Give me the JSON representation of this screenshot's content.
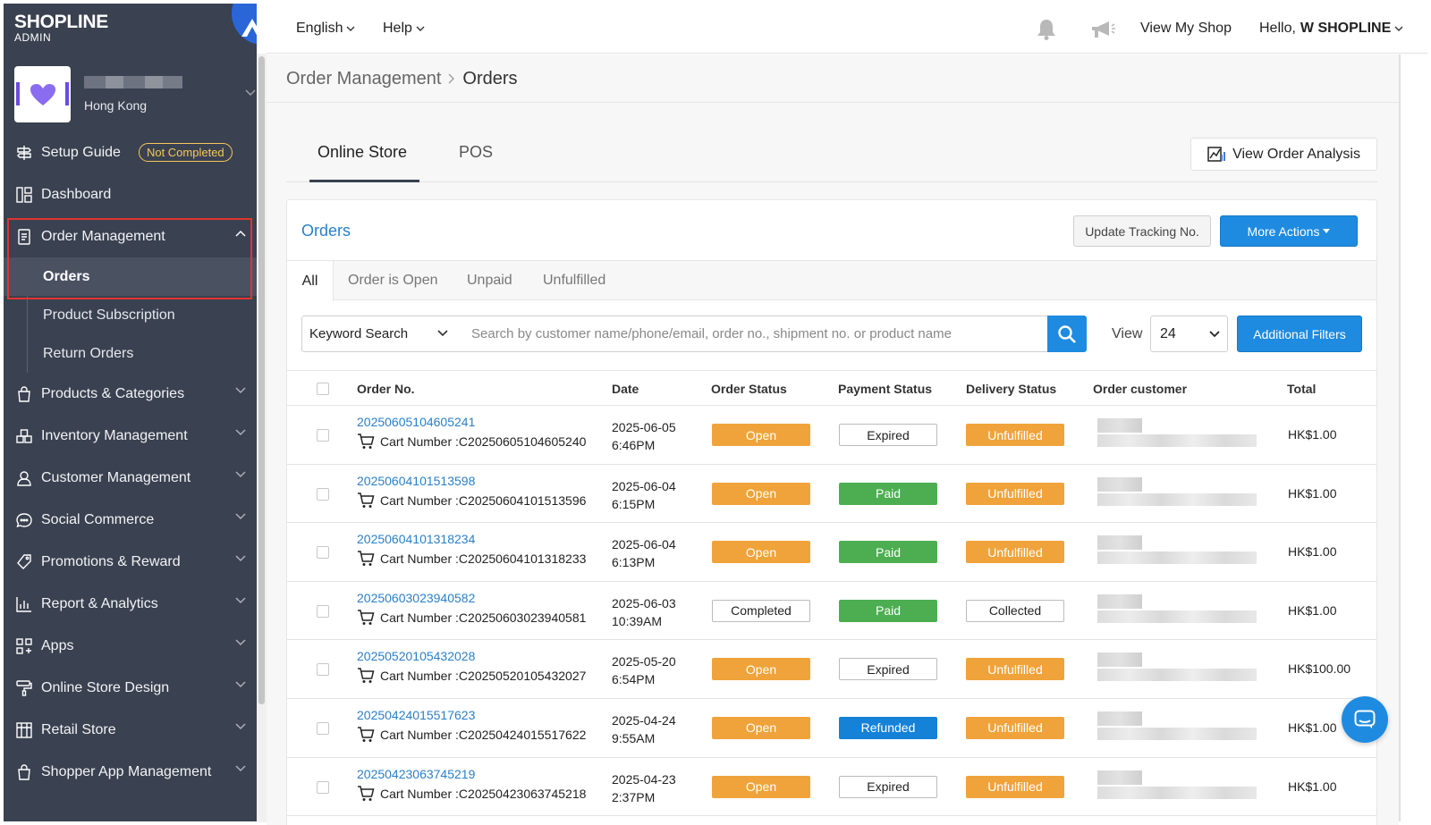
{
  "brand": {
    "logo": "SHOPLINE",
    "sub": "ADMIN"
  },
  "store": {
    "region": "Hong Kong"
  },
  "sidebar": {
    "setup_guide": {
      "label": "Setup Guide",
      "badge": "Not Completed"
    },
    "dashboard": "Dashboard",
    "order_management": {
      "label": "Order Management",
      "children": [
        "Orders",
        "Product Subscription",
        "Return Orders"
      ]
    },
    "items": [
      "Products & Categories",
      "Inventory Management",
      "Customer Management",
      "Social Commerce",
      "Promotions & Reward",
      "Report & Analytics",
      "Apps",
      "Online Store Design",
      "Retail Store",
      "Shopper App Management"
    ]
  },
  "topbar": {
    "language": "English",
    "help": "Help",
    "view_shop": "View My Shop",
    "greeting": "Hello,",
    "user": "W SHOPLINE"
  },
  "breadcrumb": {
    "parent": "Order Management",
    "current": "Orders"
  },
  "store_tabs": [
    "Online Store",
    "POS"
  ],
  "analysis_button": "View Order Analysis",
  "panel": {
    "title": "Orders",
    "update_tracking": "Update Tracking No.",
    "more_actions": "More Actions",
    "status_tabs": [
      "All",
      "Order is Open",
      "Unpaid",
      "Unfulfilled"
    ],
    "keyword_select": "Keyword Search",
    "search_placeholder": "Search by customer name/phone/email, order no., shipment no. or product name",
    "view_label": "View",
    "view_value": "24",
    "additional_filters": "Additional Filters"
  },
  "table": {
    "headers": [
      "Order No.",
      "Date",
      "Order Status",
      "Payment Status",
      "Delivery Status",
      "Order customer",
      "Total"
    ],
    "cart_prefix": "Cart Number : ",
    "rows": [
      {
        "order_no": "20250605104605241",
        "cart": "C20250605104605240",
        "date": "2025-06-05",
        "time": "6:46PM",
        "order_status": "Open",
        "payment_status": "Expired",
        "delivery_status": "Unfulfilled",
        "total": "HK$1.00"
      },
      {
        "order_no": "20250604101513598",
        "cart": "C20250604101513596",
        "date": "2025-06-04",
        "time": "6:15PM",
        "order_status": "Open",
        "payment_status": "Paid",
        "delivery_status": "Unfulfilled",
        "total": "HK$1.00"
      },
      {
        "order_no": "20250604101318234",
        "cart": "C20250604101318233",
        "date": "2025-06-04",
        "time": "6:13PM",
        "order_status": "Open",
        "payment_status": "Paid",
        "delivery_status": "Unfulfilled",
        "total": "HK$1.00"
      },
      {
        "order_no": "20250603023940582",
        "cart": "C20250603023940581",
        "date": "2025-06-03",
        "time": "10:39AM",
        "order_status": "Completed",
        "payment_status": "Paid",
        "delivery_status": "Collected",
        "total": "HK$1.00"
      },
      {
        "order_no": "20250520105432028",
        "cart": "C20250520105432027",
        "date": "2025-05-20",
        "time": "6:54PM",
        "order_status": "Open",
        "payment_status": "Expired",
        "delivery_status": "Unfulfilled",
        "total": "HK$100.00"
      },
      {
        "order_no": "20250424015517623",
        "cart": "C20250424015517622",
        "date": "2025-04-24",
        "time": "9:55AM",
        "order_status": "Open",
        "payment_status": "Refunded",
        "delivery_status": "Unfulfilled",
        "total": "HK$1.00"
      },
      {
        "order_no": "20250423063745219",
        "cart": "C20250423063745218",
        "date": "2025-04-23",
        "time": "2:37PM",
        "order_status": "Open",
        "payment_status": "Expired",
        "delivery_status": "Unfulfilled",
        "total": "HK$1.00"
      }
    ]
  },
  "colors": {
    "sidebar_bg": "#3a4150",
    "accent_blue": "#1e8be0",
    "link_blue": "#2a7fc8",
    "status_orange": "#f0a33b",
    "status_green": "#4cae51",
    "status_blue": "#1582d8",
    "highlight_red": "#e0342f"
  }
}
